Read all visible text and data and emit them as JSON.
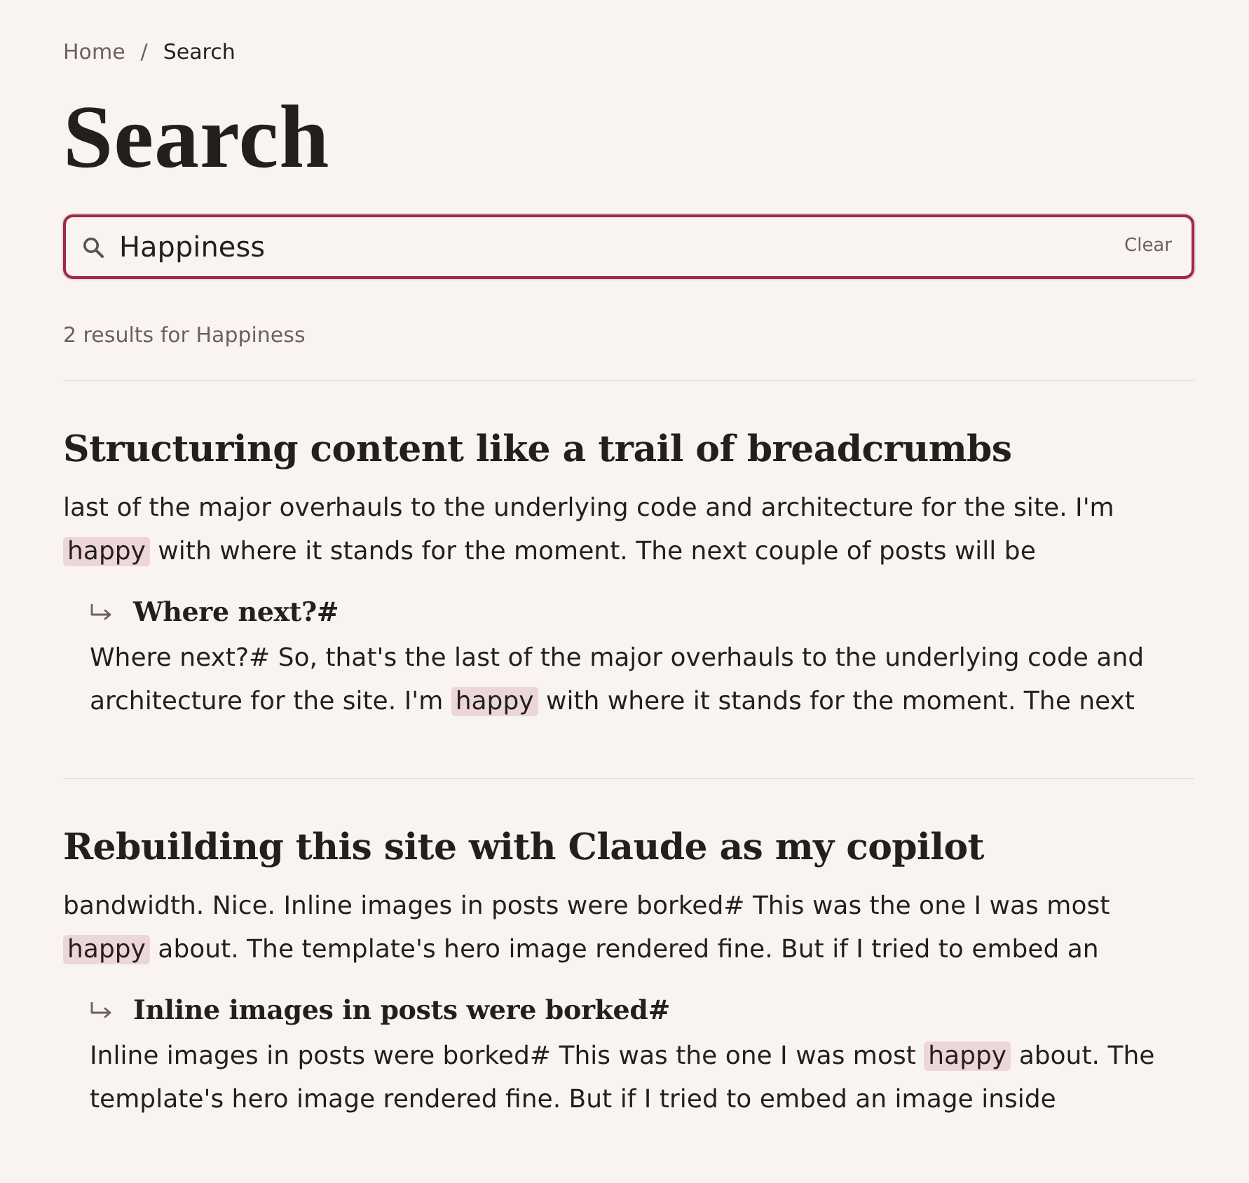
{
  "breadcrumb": [
    {
      "label": "Home",
      "current": false
    },
    {
      "label": "Search",
      "current": true
    }
  ],
  "breadcrumb_separator": "/",
  "page_title": "Search",
  "search": {
    "value": "Happiness",
    "focused": true,
    "clear_label": "Clear"
  },
  "results_summary": "2 results for Happiness",
  "results": [
    {
      "title": "Structuring content like a trail of breadcrumbs",
      "excerpt": [
        {
          "text": "last of the major overhauls to the underlying code and architecture for the site. I'm ",
          "highlighted": false
        },
        {
          "text": "happy",
          "highlighted": true
        },
        {
          "text": " with where it stands for the moment. The next couple of posts will be",
          "highlighted": false
        }
      ],
      "sections": [
        {
          "heading": "Where next?#",
          "excerpt": [
            {
              "text": "Where next?# So, that's the last of the major overhauls to the underlying code and architecture for the site. I'm ",
              "highlighted": false
            },
            {
              "text": "happy",
              "highlighted": true
            },
            {
              "text": " with where it stands for the moment. The next",
              "highlighted": false
            }
          ]
        }
      ]
    },
    {
      "title": "Rebuilding this site with Claude as my copilot",
      "excerpt": [
        {
          "text": "bandwidth. Nice. Inline images in posts were borked# This was the one I was most ",
          "highlighted": false
        },
        {
          "text": "happy",
          "highlighted": true
        },
        {
          "text": " about. The template's hero image rendered fine. But if I tried to embed an",
          "highlighted": false
        }
      ],
      "sections": [
        {
          "heading": "Inline images in posts were borked#",
          "excerpt": [
            {
              "text": "Inline images in posts were borked# This was the one I was most ",
              "highlighted": false
            },
            {
              "text": "happy",
              "highlighted": true
            },
            {
              "text": " about. The template's hero image rendered fine. But if I tried to embed an image inside",
              "highlighted": false
            }
          ]
        }
      ]
    }
  ]
}
